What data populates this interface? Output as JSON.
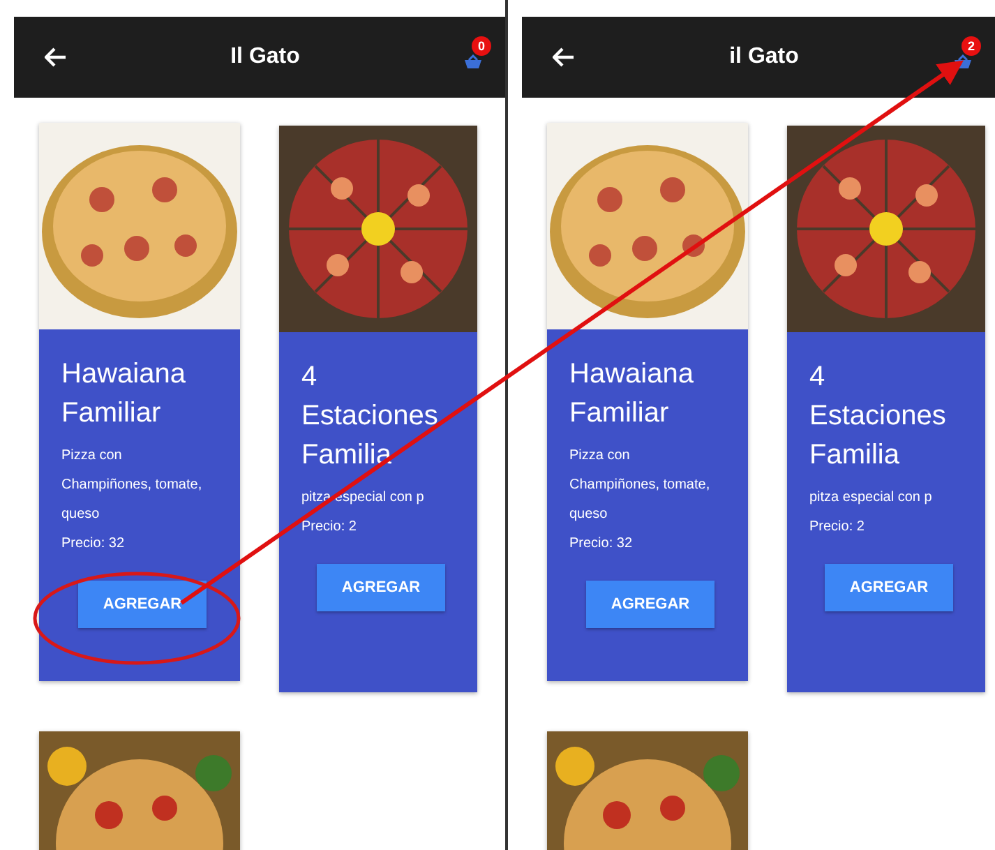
{
  "panels": [
    {
      "header": {
        "title": "Il Gato",
        "cart_count": "0"
      },
      "products": [
        {
          "name": "Hawaiana Familiar",
          "description": "Pizza con Champiñones, tomate, queso",
          "price": "Precio: 32",
          "button": "AGREGAR"
        },
        {
          "name": "4 Estaciones Familia",
          "description": "pitza especial con p",
          "price": "Precio: 2",
          "button": "AGREGAR"
        },
        {
          "kind": "partial"
        }
      ]
    },
    {
      "header": {
        "title": "il Gato",
        "cart_count": "2"
      },
      "products": [
        {
          "name": "Hawaiana Familiar",
          "description": "Pizza con Champiñones, tomate, queso",
          "price": "Precio: 32",
          "button": "AGREGAR"
        },
        {
          "name": "4 Estaciones Familia",
          "description": "pitza especial con p",
          "price": "Precio: 2",
          "button": "AGREGAR"
        },
        {
          "kind": "partial"
        }
      ]
    }
  ]
}
